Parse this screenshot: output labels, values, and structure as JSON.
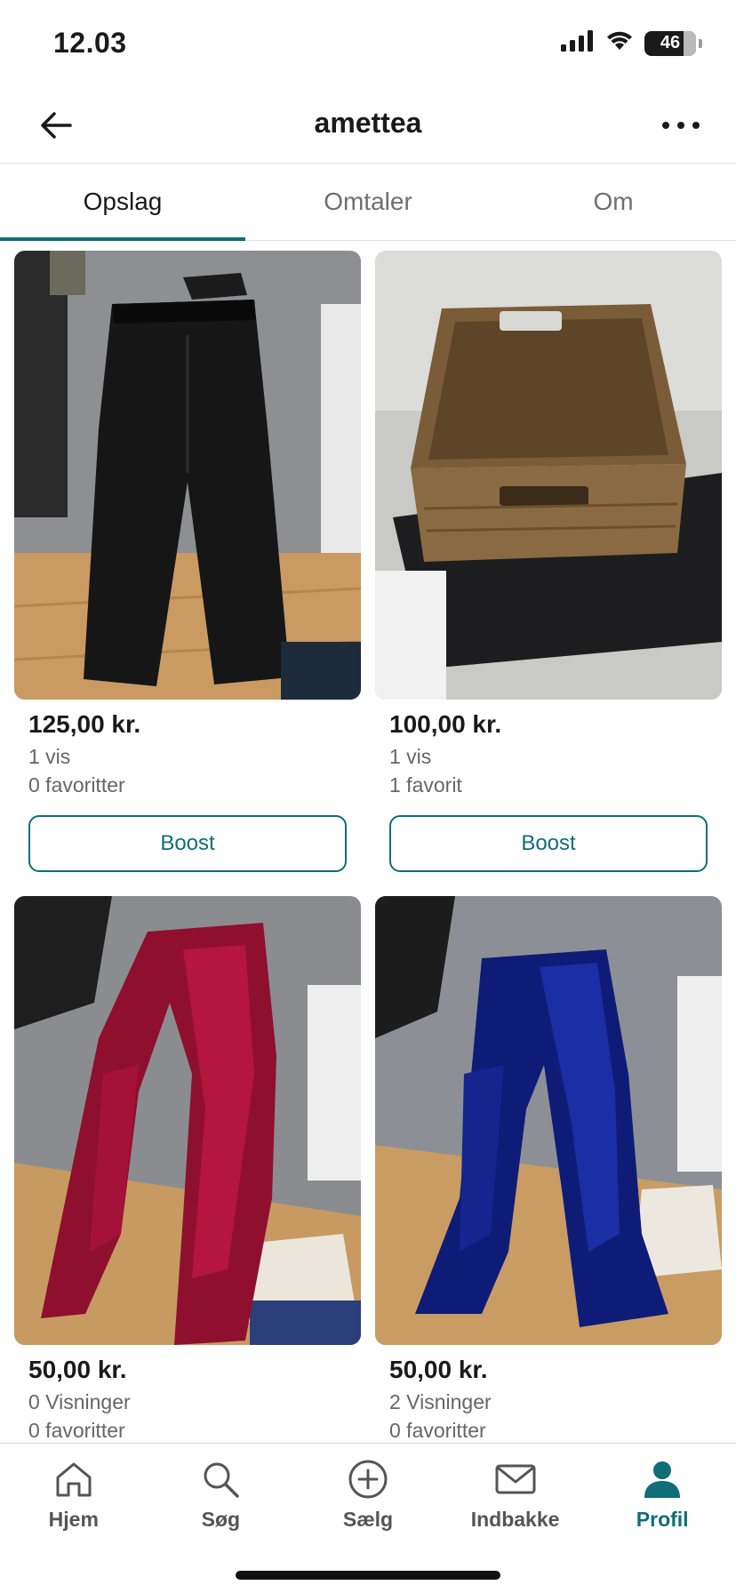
{
  "status_bar": {
    "time": "12.03",
    "battery": "46"
  },
  "header": {
    "title": "amettea"
  },
  "tabs": [
    {
      "label": "Opslag",
      "active": true
    },
    {
      "label": "Omtaler",
      "active": false
    },
    {
      "label": "Om",
      "active": false
    }
  ],
  "listings": [
    {
      "image": "black-snow-pants",
      "price": "125,00 kr.",
      "views": "1 vis",
      "favorites": "0 favoritter",
      "action": "Boost"
    },
    {
      "image": "wicker-basket",
      "price": "100,00 kr.",
      "views": "1 vis",
      "favorites": "1 favorit",
      "action": "Boost"
    },
    {
      "image": "red-velvet-scarf",
      "price": "50,00 kr.",
      "views": "0 Visninger",
      "favorites": "0 favoritter"
    },
    {
      "image": "blue-velvet-scarf",
      "price": "50,00 kr.",
      "views": "2 Visninger",
      "favorites": "0 favoritter"
    }
  ],
  "bottom_nav": [
    {
      "label": "Hjem",
      "icon": "home-icon",
      "active": false
    },
    {
      "label": "Søg",
      "icon": "search-icon",
      "active": false
    },
    {
      "label": "Sælg",
      "icon": "plus-circle-icon",
      "active": false
    },
    {
      "label": "Indbakke",
      "icon": "mail-icon",
      "active": false
    },
    {
      "label": "Profil",
      "icon": "profile-icon",
      "active": true
    }
  ],
  "colors": {
    "accent": "#0f6e76",
    "text": "#1a1a1a",
    "muted": "#666666"
  }
}
